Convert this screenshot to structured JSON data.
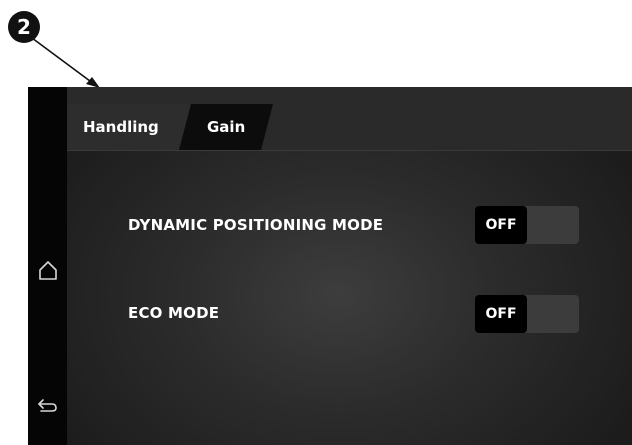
{
  "callout": {
    "number": "2"
  },
  "sidebar": {
    "home_icon": "home-icon",
    "back_icon": "back-arrow-icon"
  },
  "tabs": [
    {
      "label": "Handling",
      "active": false
    },
    {
      "label": "Gain",
      "active": true
    }
  ],
  "settings": [
    {
      "label": "DYNAMIC POSITIONING MODE",
      "state": "OFF"
    },
    {
      "label": "ECO MODE",
      "state": "OFF"
    }
  ],
  "colors": {
    "screen_bg": "#1f1f1f",
    "sidebar_bg": "#050505",
    "active_tab_bg": "#0c0c0c",
    "toggle_track": "#3c3c3c",
    "toggle_knob": "#000000"
  }
}
